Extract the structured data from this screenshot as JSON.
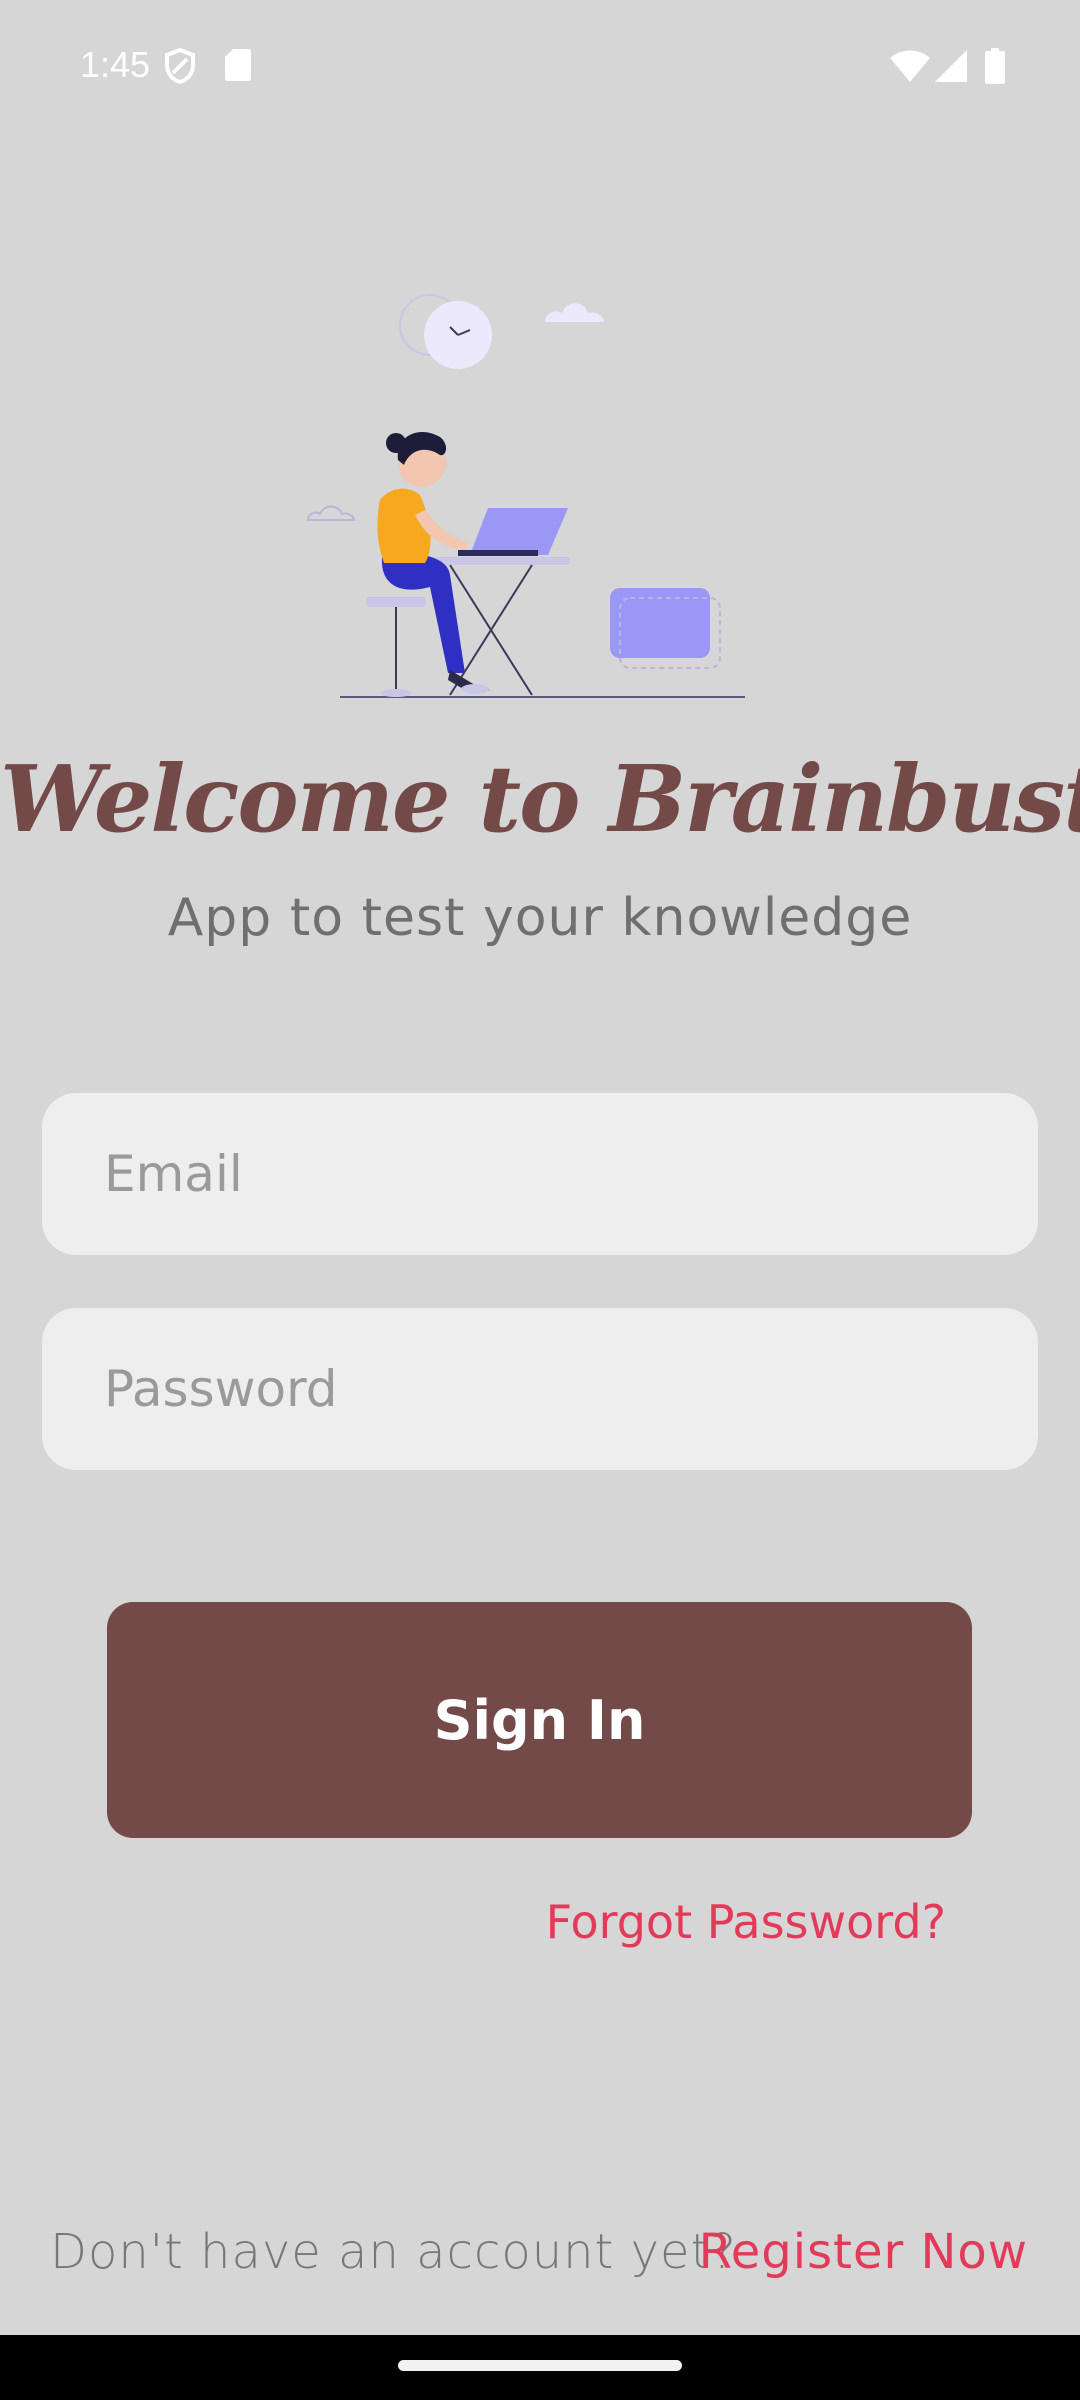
{
  "status_bar": {
    "time": "1:45",
    "icons": [
      "shield-icon",
      "sd-card-icon",
      "wifi-icon",
      "signal-icon",
      "battery-icon"
    ]
  },
  "header": {
    "title": "Welcome to Brainbuster",
    "subtitle": "App to test your knowledge"
  },
  "form": {
    "email_placeholder": "Email",
    "email_value": "",
    "password_placeholder": "Password",
    "password_value": "",
    "signin_label": "Sign In",
    "forgot_label": "Forgot Password?"
  },
  "footer": {
    "no_account_text": "Don't have an account yet?",
    "register_label": "Register Now"
  },
  "colors": {
    "background": "#d6d6d6",
    "brand": "#744a48",
    "link": "#e33a5a",
    "field": "#eeeeee"
  }
}
